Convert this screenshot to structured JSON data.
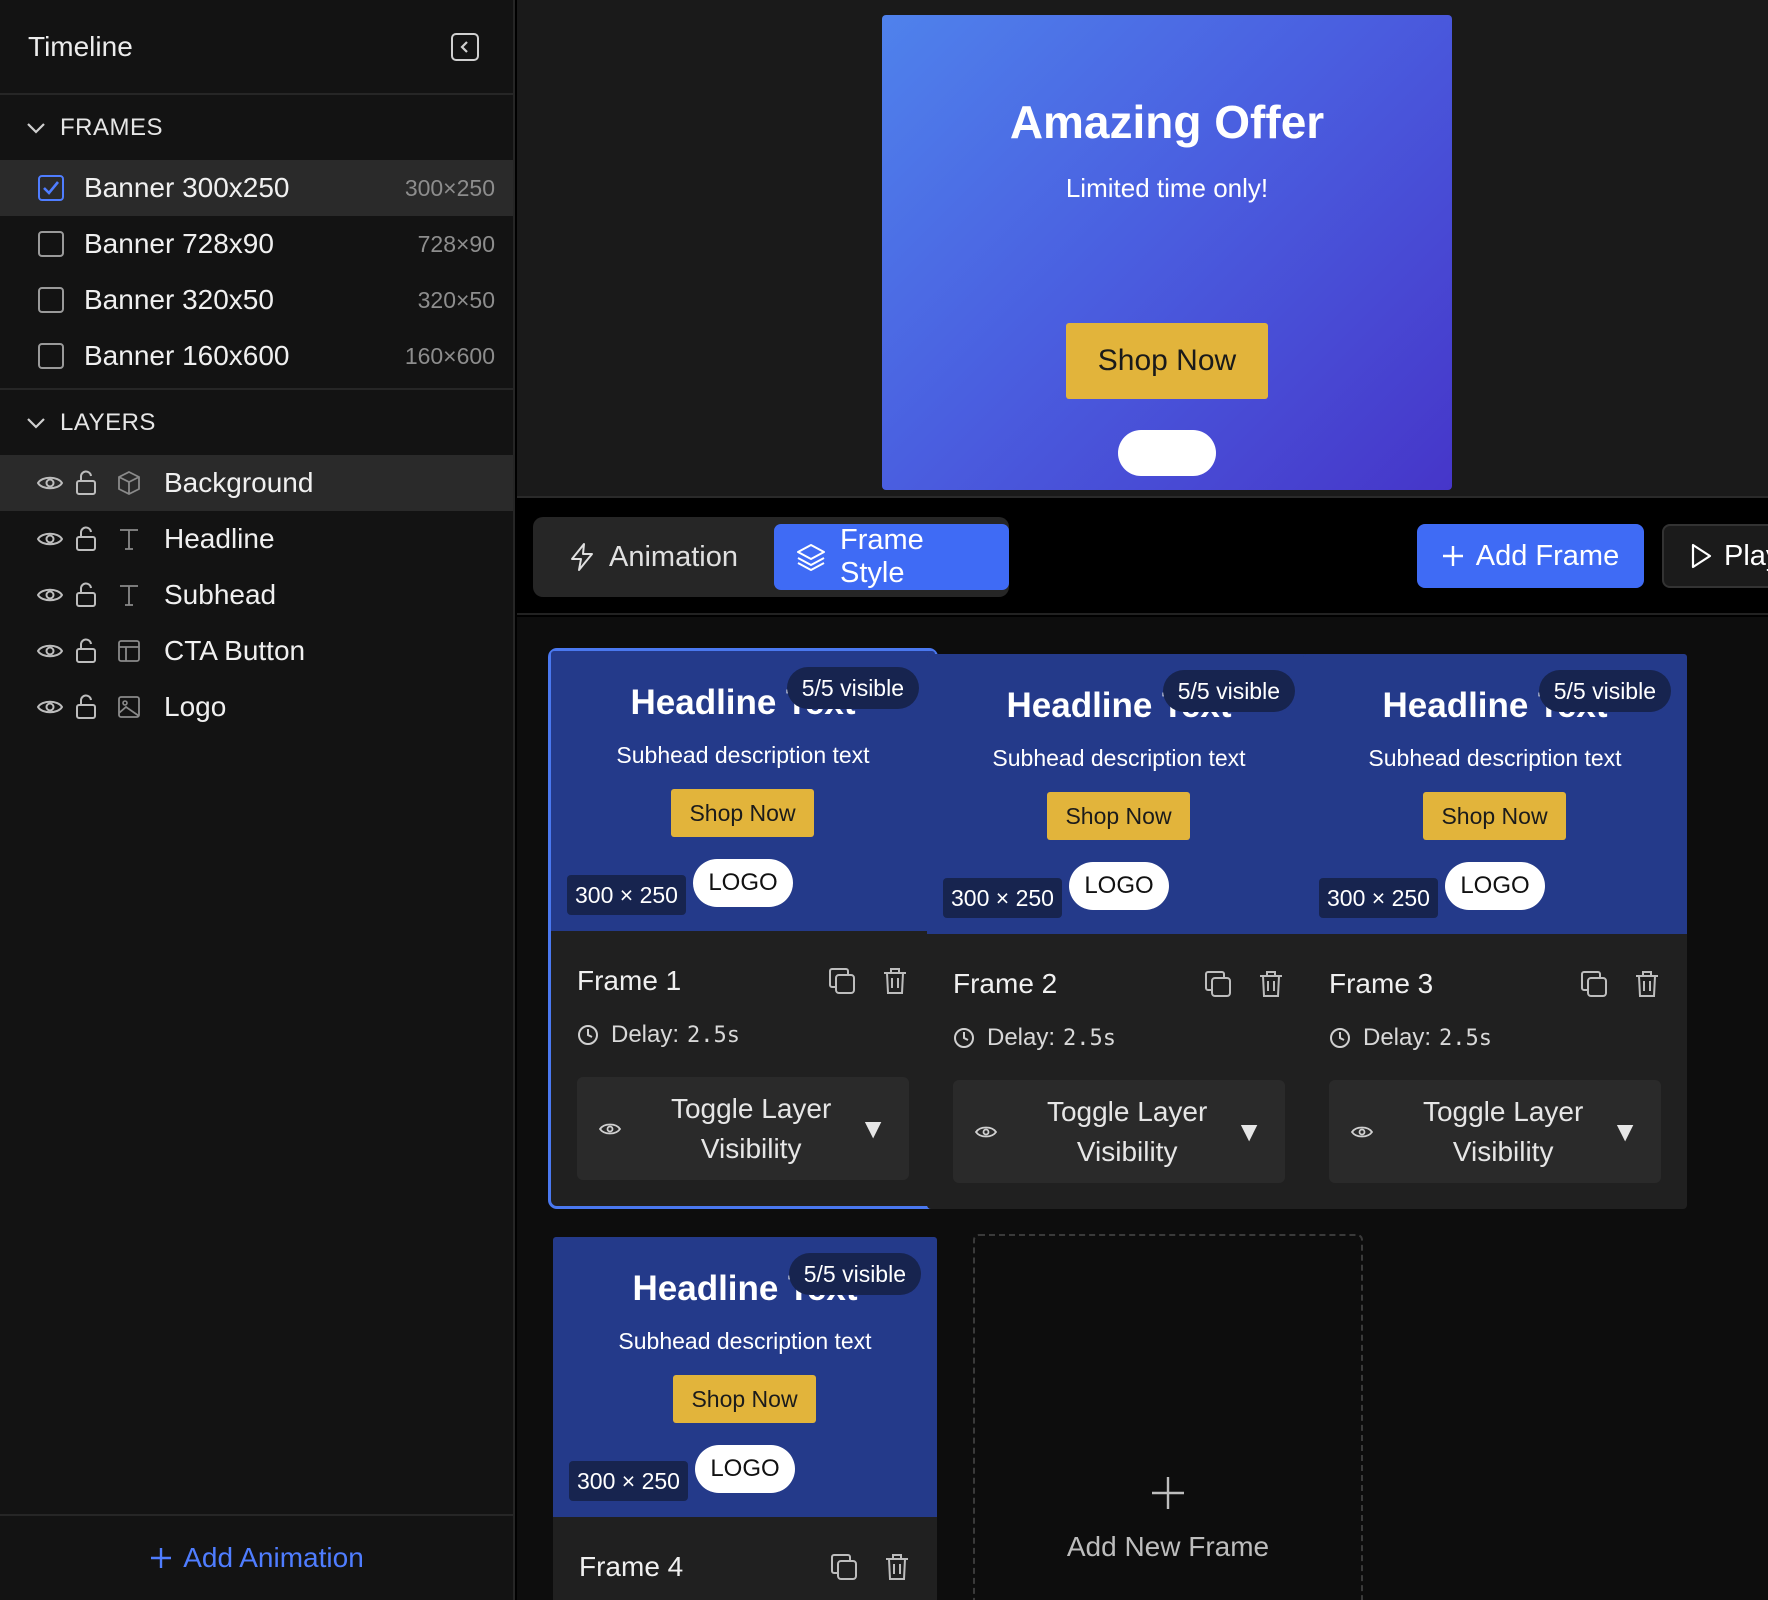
{
  "sidebar": {
    "title": "Timeline",
    "frames_section": "FRAMES",
    "frames": [
      {
        "name": "Banner 300x250",
        "size": "300×250",
        "checked": true
      },
      {
        "name": "Banner 728x90",
        "size": "728×90",
        "checked": false
      },
      {
        "name": "Banner 320x50",
        "size": "320×50",
        "checked": false
      },
      {
        "name": "Banner 160x600",
        "size": "160×600",
        "checked": false
      }
    ],
    "layers_section": "LAYERS",
    "layers": [
      {
        "name": "Background",
        "type_icon": "cube-icon"
      },
      {
        "name": "Headline",
        "type_icon": "text-icon"
      },
      {
        "name": "Subhead",
        "type_icon": "text-icon"
      },
      {
        "name": "CTA Button",
        "type_icon": "layout-icon"
      },
      {
        "name": "Logo",
        "type_icon": "image-icon"
      }
    ],
    "add_animation": "Add Animation"
  },
  "preview": {
    "title": "Amazing Offer",
    "subtitle": "Limited time only!",
    "cta": "Shop Now"
  },
  "toolbar": {
    "tab_animation": "Animation",
    "tab_frame_style": "Frame Style",
    "add_frame": "Add Frame",
    "play": "Play"
  },
  "frames": [
    {
      "title": "Frame 1",
      "headline": "Headline Text",
      "badge": "5/5 visible",
      "subhead": "Subhead description text",
      "cta": "Shop Now",
      "size": "300 × 250",
      "logo": "LOGO",
      "delay_label": "Delay:",
      "delay": "2.5s",
      "toggle": "Toggle Layer Visibility"
    },
    {
      "title": "Frame 2",
      "headline": "Headline Text",
      "badge": "5/5 visible",
      "subhead": "Subhead description text",
      "cta": "Shop Now",
      "size": "300 × 250",
      "logo": "LOGO",
      "delay_label": "Delay:",
      "delay": "2.5s",
      "toggle": "Toggle Layer Visibility"
    },
    {
      "title": "Frame 3",
      "headline": "Headline Text",
      "badge": "5/5 visible",
      "subhead": "Subhead description text",
      "cta": "Shop Now",
      "size": "300 × 250",
      "logo": "LOGO",
      "delay_label": "Delay:",
      "delay": "2.5s",
      "toggle": "Toggle Layer Visibility"
    },
    {
      "title": "Frame 4",
      "headline": "Headline Text",
      "badge": "5/5 visible",
      "subhead": "Subhead description text",
      "cta": "Shop Now",
      "size": "300 × 250",
      "logo": "LOGO"
    }
  ],
  "add_new_frame": "Add New Frame",
  "colors": {
    "accent": "#3f6bf5",
    "cta_yellow": "#e2b43b",
    "thumb_blue": "#243a8a"
  }
}
